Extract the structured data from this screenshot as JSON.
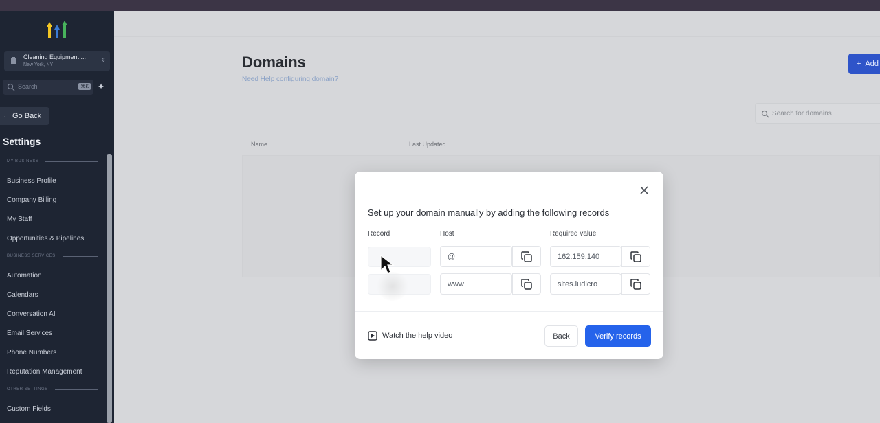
{
  "sidebar": {
    "location": {
      "name": "Cleaning Equipment ...",
      "sub": "New York, NY"
    },
    "search": {
      "placeholder": "Search",
      "shortcut": "⌘K"
    },
    "go_back": "Go Back",
    "title": "Settings",
    "sections": [
      {
        "label": "MY BUSINESS"
      },
      {
        "label": "BUSINESS SERVICES"
      },
      {
        "label": "OTHER SETTINGS"
      }
    ],
    "items": [
      {
        "label": "Business Profile"
      },
      {
        "label": "Company Billing"
      },
      {
        "label": "My Staff"
      },
      {
        "label": "Opportunities & Pipelines"
      },
      {
        "label": "Automation"
      },
      {
        "label": "Calendars"
      },
      {
        "label": "Conversation AI"
      },
      {
        "label": "Email Services"
      },
      {
        "label": "Phone Numbers"
      },
      {
        "label": "Reputation Management"
      },
      {
        "label": "Custom Fields"
      }
    ]
  },
  "main": {
    "title": "Domains",
    "help": "Need Help configuring domain?",
    "add_button": "Add",
    "search_placeholder": "Search for domains",
    "columns": [
      "Name",
      "Last Updated"
    ]
  },
  "modal": {
    "title": "Set up your domain manually by adding the following records",
    "headers": {
      "record": "Record",
      "host": "Host",
      "value": "Required value"
    },
    "rows": [
      {
        "host": "@",
        "value": "162.159.140"
      },
      {
        "host": "www",
        "value": "sites.ludicro"
      }
    ],
    "help_link": "Watch the help video",
    "back": "Back",
    "verify": "Verify records"
  },
  "colors": {
    "primary": "#2563eb",
    "sidebar": "#1e2533"
  }
}
